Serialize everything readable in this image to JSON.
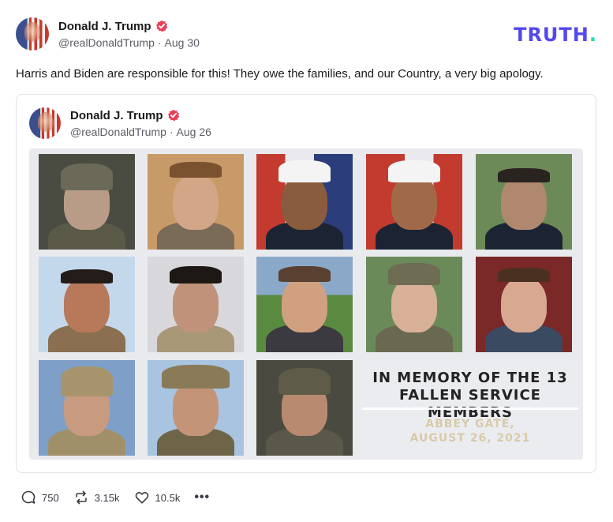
{
  "post": {
    "author": {
      "display_name": "Donald J. Trump",
      "handle": "@realDonaldTrump",
      "date": "Aug 30"
    },
    "text": "Harris and Biden are responsible for this! They owe the families, and our Country, a very big apology.",
    "stats": {
      "replies": "750",
      "retruths": "3.15k",
      "likes": "10.5k"
    }
  },
  "brand": {
    "logo_text": "TRUTH",
    "logo_dot": ".",
    "accent": "#5448ee",
    "dot_color": "#17e0b3",
    "verified_color": "#e8425a"
  },
  "quoted_post": {
    "author": {
      "display_name": "Donald J. Trump",
      "handle": "@realDonaldTrump",
      "date": "Aug 26"
    },
    "image": {
      "title_line1": "IN MEMORY OF THE 13",
      "title_line2": "FALLEN SERVICE MEMBERS",
      "subtitle_line1": "ABBEY GATE,",
      "subtitle_line2": "AUGUST 26, 2021",
      "photos": [
        {
          "icon": "portrait-helmet-goggles"
        },
        {
          "icon": "portrait-casual"
        },
        {
          "icon": "portrait-dress-blues-cap"
        },
        {
          "icon": "portrait-dress-blues-cap"
        },
        {
          "icon": "portrait-dress-blues-glasses"
        },
        {
          "icon": "portrait-selfie"
        },
        {
          "icon": "portrait-glasses"
        },
        {
          "icon": "portrait-outdoor-sunglasses"
        },
        {
          "icon": "portrait-camo-cover"
        },
        {
          "icon": "portrait-camo"
        },
        {
          "icon": "portrait-helmet-desert"
        },
        {
          "icon": "portrait-boonie-hat"
        },
        {
          "icon": "portrait-helmet-gear"
        }
      ]
    }
  }
}
